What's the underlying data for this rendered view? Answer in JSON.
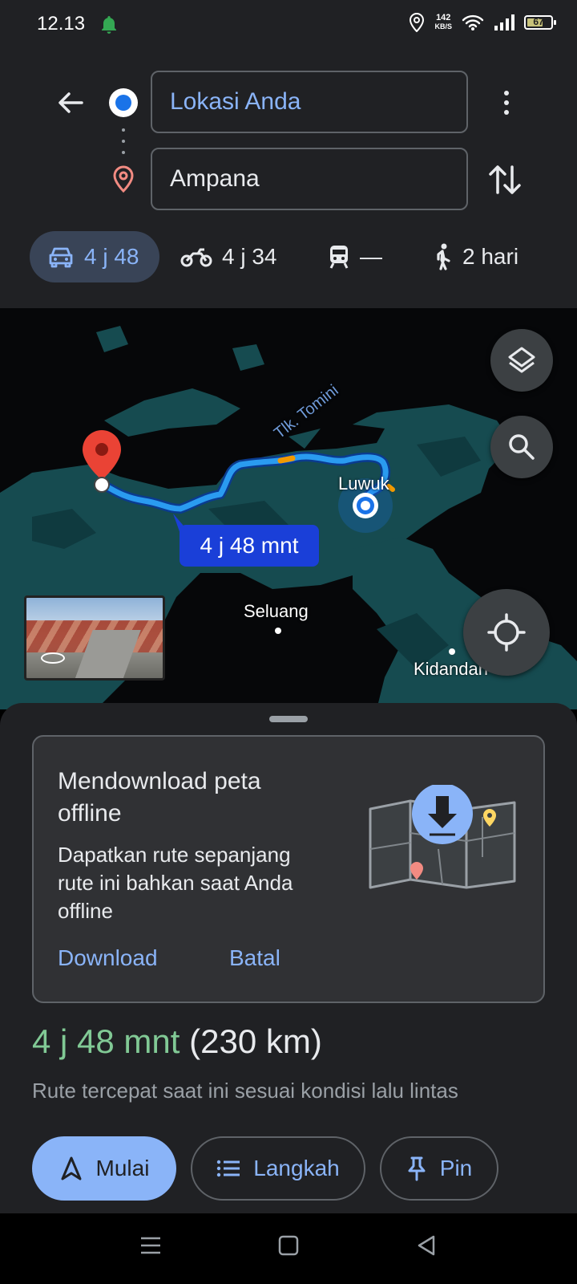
{
  "status_bar": {
    "time": "12.13",
    "net_speed_value": "142",
    "net_speed_unit": "KB/S",
    "battery_level": "67"
  },
  "directions": {
    "origin_value": "Lokasi Anda",
    "destination_value": "Ampana",
    "modes": [
      {
        "name": "car",
        "label": "4 j 48",
        "selected": true
      },
      {
        "name": "motorcycle",
        "label": "4 j 34",
        "selected": false
      },
      {
        "name": "transit",
        "label": "—",
        "selected": false
      },
      {
        "name": "walk",
        "label": "2 hari",
        "selected": false
      }
    ]
  },
  "map": {
    "labels": {
      "gulf": "Tlk. Tomini",
      "luwuk": "Luwuk",
      "seluang": "Seluang",
      "kidandan": "Kidandan"
    },
    "route_time_bubble": "4 j 48 mnt"
  },
  "offline_card": {
    "title": "Mendownload peta offline",
    "body": "Dapatkan rute sepanjang rute ini bahkan saat Anda offline",
    "download_label": "Download",
    "cancel_label": "Batal"
  },
  "summary": {
    "duration": "4 j 48 mnt",
    "distance": "(230 km)",
    "note": "Rute tercepat saat ini sesuai kondisi lalu lintas"
  },
  "actions": {
    "start_label": "Mulai",
    "steps_label": "Langkah",
    "pin_label": "Pin"
  },
  "colors": {
    "accent": "#8ab4f8",
    "duration_green": "#81c995",
    "route_blue": "#1a73e8",
    "destination_red": "#ea4335",
    "traffic_orange": "#f29900"
  }
}
